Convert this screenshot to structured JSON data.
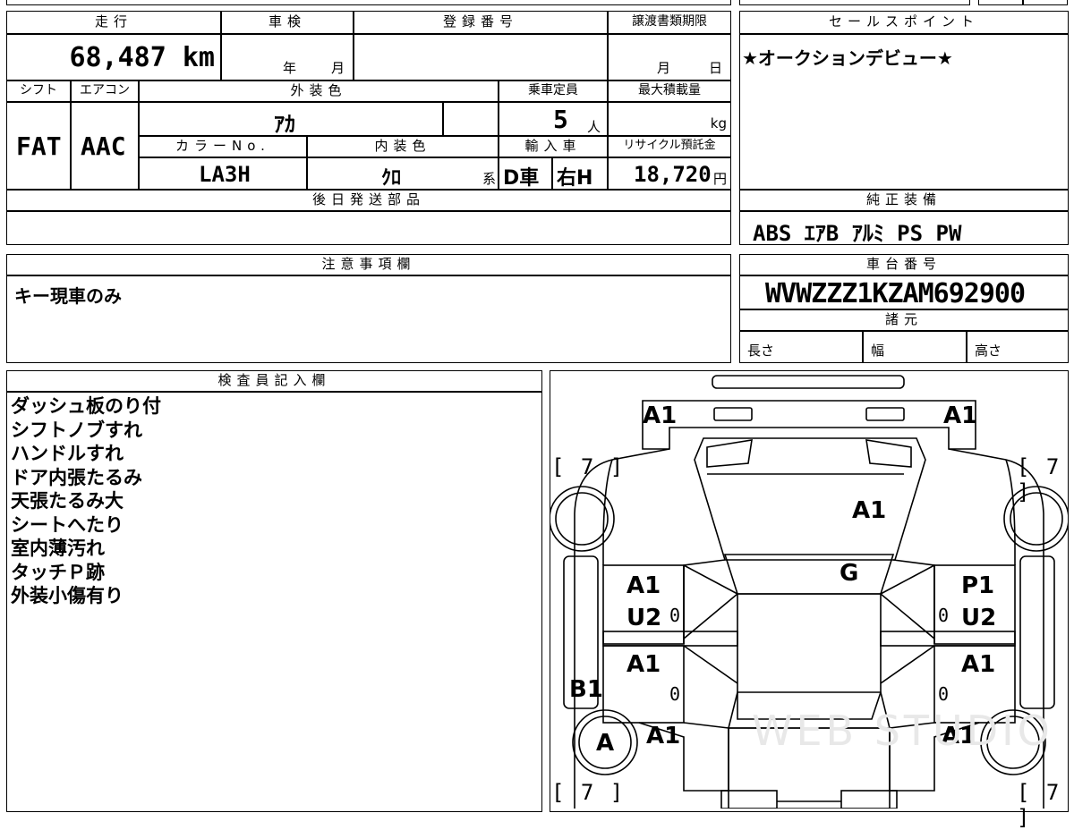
{
  "top": {
    "mileage_label": "走行",
    "mileage_value": "68,487 km",
    "inspection_label": "車検",
    "inspection_year": "年",
    "inspection_month": "月",
    "registration_label": "登録番号",
    "transfer_label": "譲渡書類期限",
    "transfer_month": "月",
    "transfer_day": "日"
  },
  "specs": {
    "shift_label": "シフト",
    "shift_value": "FAT",
    "ac_label": "エアコン",
    "ac_value": "AAC",
    "exterior_label": "外装色",
    "exterior_value": "ｱｶ",
    "capacity_label": "乗車定員",
    "capacity_value": "5",
    "capacity_unit": "人",
    "load_label": "最大積載量",
    "load_unit": "kg",
    "color_no_label": "カラーNo.",
    "color_no_value": "LA3H",
    "interior_label": "内装色",
    "interior_value": "ｸﾛ",
    "interior_suffix": "系",
    "import_label": "輸入車",
    "import_value1": "D車",
    "import_value2": "右H",
    "recycle_label": "リサイクル預託金",
    "recycle_value": "18,720",
    "recycle_unit": "円"
  },
  "later_parts_label": "後日発送部品",
  "sales_point": {
    "label": "セールスポイント",
    "text": "★オークションデビュー★"
  },
  "equipment": {
    "label": "純正装備",
    "text": "ABS ｴｱB ｱﾙﾐ PS PW"
  },
  "notes": {
    "label": "注意事項欄",
    "text": "キー現車のみ"
  },
  "chassis": {
    "label": "車台番号",
    "value": "WVWZZZ1KZAM692900",
    "dims_label": "諸元",
    "length_label": "長さ",
    "width_label": "幅",
    "height_label": "高さ"
  },
  "inspector": {
    "label": "検査員記入欄",
    "lines": [
      "ダッシュ板のり付",
      "シフトノブすれ",
      "ハンドルすれ",
      "ドア内張たるみ",
      "天張たるみ大",
      "シートへたり",
      "室内薄汚れ",
      "タッチＰ跡",
      "外装小傷有り"
    ]
  },
  "diagram": {
    "front_left": "A1",
    "front_right": "A1",
    "bonnet": "A1",
    "windshield": "G",
    "fl_door": "A1",
    "fl_door2": "U2",
    "fr_door": "P1",
    "fr_door2": "U2",
    "rl_door": "A1",
    "rr_door": "A1",
    "left_sill": "B1",
    "rl_wheel": "A",
    "rl_fender": "A1",
    "rr_fender": "A1",
    "tire_tl": "[ 7 ]",
    "tire_tr": "[ 7 ]",
    "tire_bl": "[ 7 ]",
    "tire_br": "[ 7 ]",
    "zero1": "0",
    "zero2": "0",
    "zero3": "0",
    "zero4": "0",
    "watermark": "WEB STUDIO"
  }
}
